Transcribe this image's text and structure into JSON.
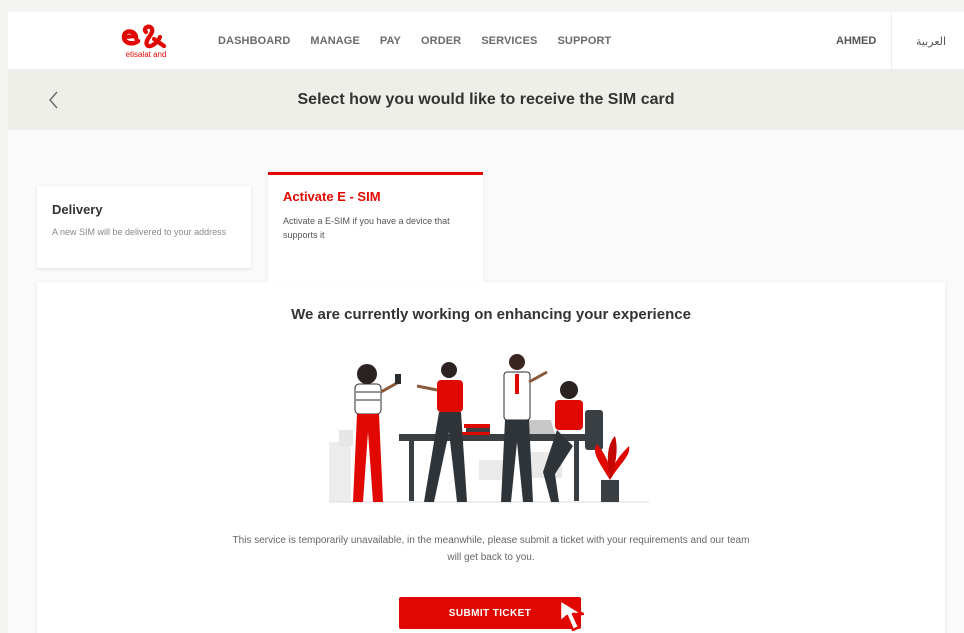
{
  "brand": {
    "name_sub": "etisalat and",
    "accent": "#e00800"
  },
  "nav": {
    "items": [
      "DASHBOARD",
      "MANAGE",
      "PAY",
      "ORDER",
      "SERVICES",
      "SUPPORT"
    ],
    "user": "AHMED",
    "language": "العربية"
  },
  "subheader": {
    "title": "Select how you would like to receive the SIM card"
  },
  "options": {
    "delivery": {
      "title": "Delivery",
      "desc": "A new SIM will be delivered to your address"
    },
    "esim": {
      "title": "Activate E - SIM",
      "desc": "Activate a E-SIM if you have a device that supports it",
      "selected": true
    }
  },
  "panel": {
    "title": "We are currently working on enhancing your experience",
    "message": "This service is temporarily unavailable, in the meanwhile, please submit a ticket with your requirements and our team will get back to you.",
    "button": "SUBMIT TICKET"
  },
  "icons": [
    "etisalat-logo",
    "chevron-left-icon",
    "team-illustration",
    "pointer-cursor-icon"
  ]
}
